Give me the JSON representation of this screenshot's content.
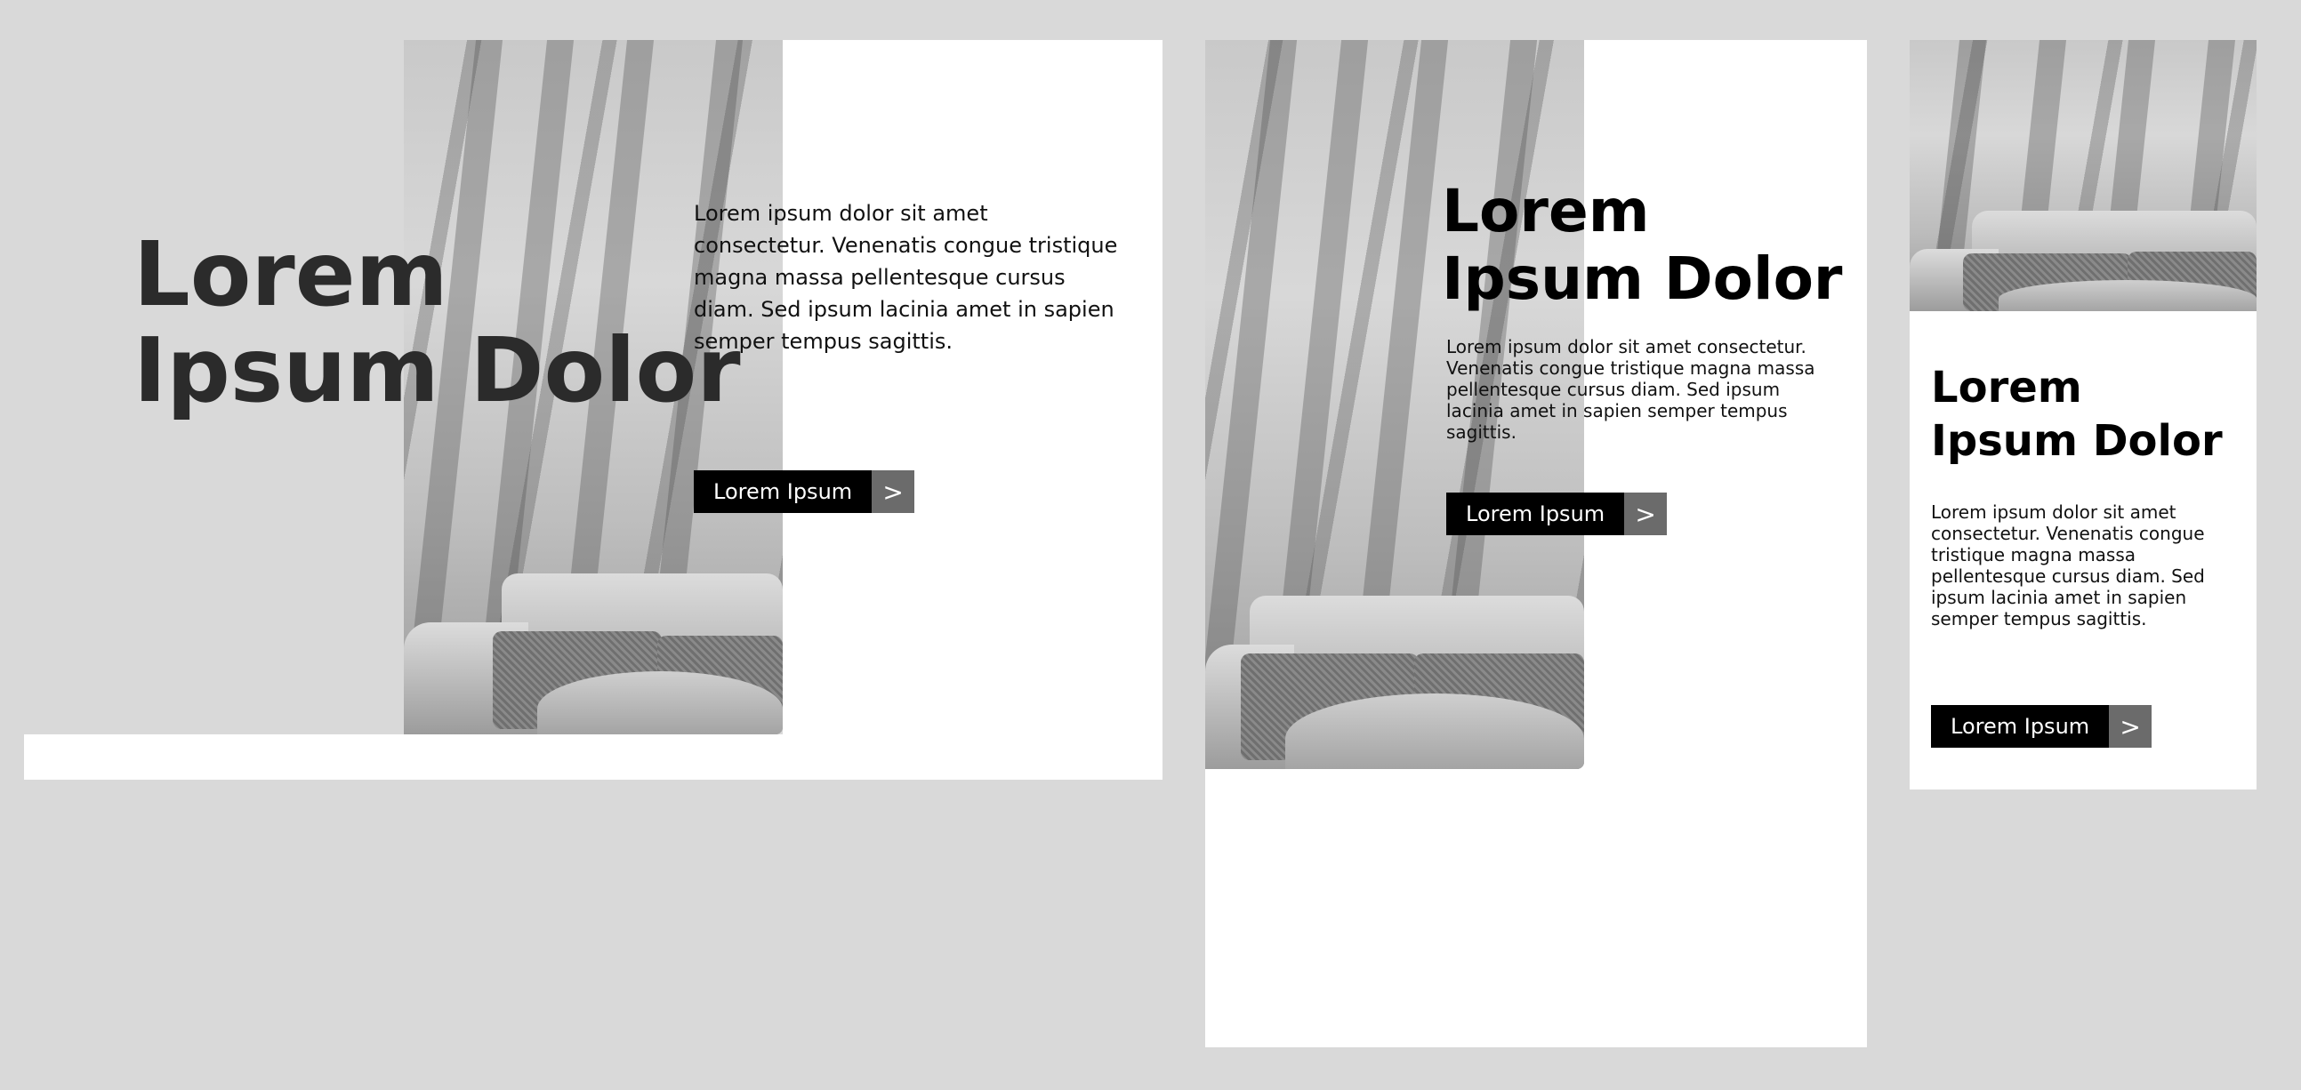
{
  "variants": [
    {
      "headline_line1": "Lorem",
      "headline_line2": "Ipsum Dolor",
      "body": "Lorem ipsum dolor sit amet consectetur. Venenatis congue tristique magna massa pellentesque cursus diam. Sed ipsum lacinia amet in sapien semper tempus sagittis.",
      "cta_label": "Lorem Ipsum",
      "cta_arrow": ">",
      "photo_icon": "room-photo"
    },
    {
      "headline_line1": "Lorem",
      "headline_line2": "Ipsum Dolor",
      "body": "Lorem ipsum dolor sit amet consectetur. Venenatis congue tristique magna massa pellentesque cursus diam. Sed ipsum lacinia amet in sapien semper tempus sagittis.",
      "cta_label": "Lorem Ipsum",
      "cta_arrow": ">",
      "photo_icon": "room-photo"
    },
    {
      "headline_line1": "Lorem",
      "headline_line2": "Ipsum Dolor",
      "body": "Lorem ipsum dolor sit amet consectetur. Venenatis congue tristique magna massa pellentesque cursus diam. Sed ipsum lacinia amet in sapien semper tempus sagittis.",
      "cta_label": "Lorem Ipsum",
      "cta_arrow": ">",
      "photo_icon": "room-photo"
    }
  ],
  "colors": {
    "page_bg": "#d9d9d9",
    "card_bg": "#ffffff",
    "headline_dark": "#2b2b2b",
    "headline_black": "#000000",
    "button_bg": "#000000",
    "arrow_bg": "#6b6b6b"
  }
}
